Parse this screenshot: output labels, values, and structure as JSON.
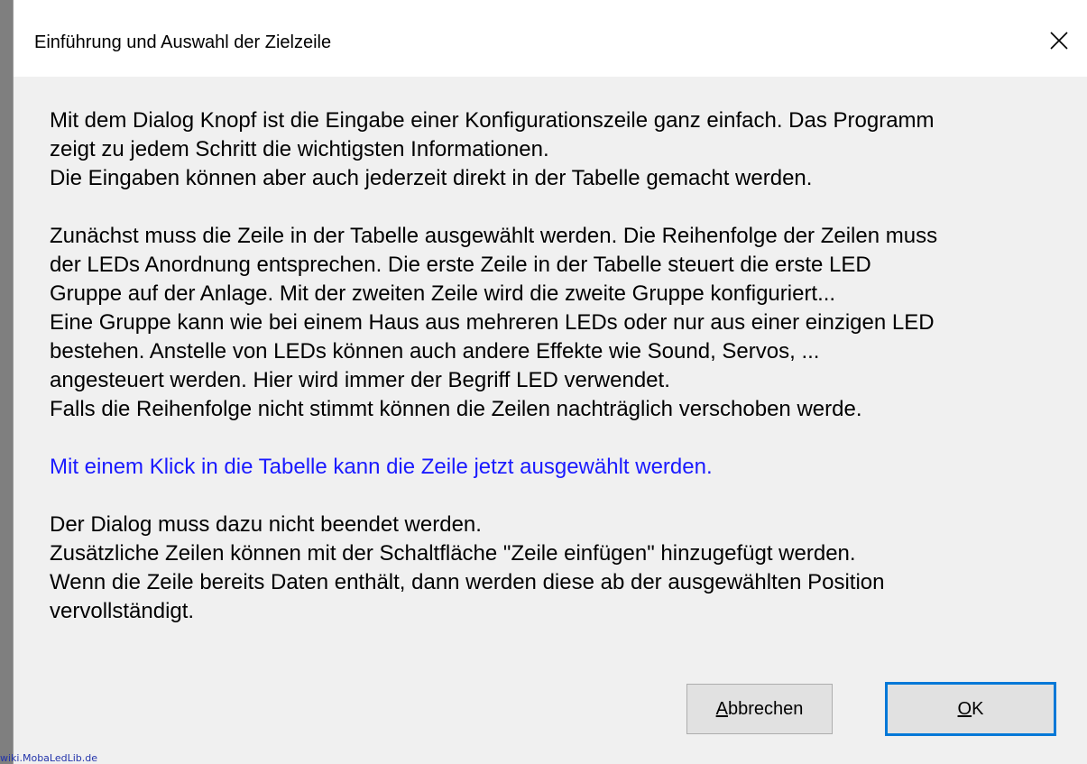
{
  "window": {
    "title": "Einführung und Auswahl der Zielzeile",
    "close_icon": "close-icon"
  },
  "content": {
    "paragraph1": [
      "Mit dem Dialog Knopf ist die Eingabe einer Konfigurationszeile ganz einfach. Das Programm",
      "zeigt zu jedem Schritt die wichtigsten Informationen.",
      "Die Eingaben können aber auch jederzeit direkt in der Tabelle gemacht werden."
    ],
    "paragraph2": [
      "Zunächst muss die Zeile in der Tabelle ausgewählt werden. Die Reihenfolge der Zeilen muss",
      "der LEDs Anordnung entsprechen. Die erste Zeile in der Tabelle steuert die erste LED",
      "Gruppe auf der Anlage. Mit der zweiten Zeile wird die zweite Gruppe konfiguriert...",
      "Eine Gruppe kann wie bei einem Haus aus mehreren LEDs oder nur aus einer einzigen LED",
      "bestehen. Anstelle von LEDs können auch andere Effekte wie Sound, Servos, ...",
      "angesteuert werden. Hier wird immer der Begriff LED verwendet.",
      "Falls die Reihenfolge nicht stimmt können die Zeilen nachträglich verschoben werde."
    ],
    "highlight": "Mit einem Klick in die Tabelle kann die Zeile jetzt ausgewählt werden.",
    "paragraph3": [
      "Der Dialog muss dazu nicht beendet werden.",
      "Zusätzliche Zeilen können mit der Schaltfläche \"Zeile einfügen\" hinzugefügt werden.",
      "Wenn die Zeile bereits Daten enthält, dann werden diese ab der ausgewählten Position",
      "vervollständigt."
    ]
  },
  "buttons": {
    "cancel_accel": "A",
    "cancel_rest": "bbrechen",
    "ok_accel": "O",
    "ok_rest": "K"
  },
  "watermark": "wiki.MobaLedLib.de",
  "colors": {
    "highlight": "#1a1aff",
    "dialog_bg": "#f0f0f0",
    "button_bg": "#e1e1e1",
    "focus_border": "#0078d7"
  }
}
